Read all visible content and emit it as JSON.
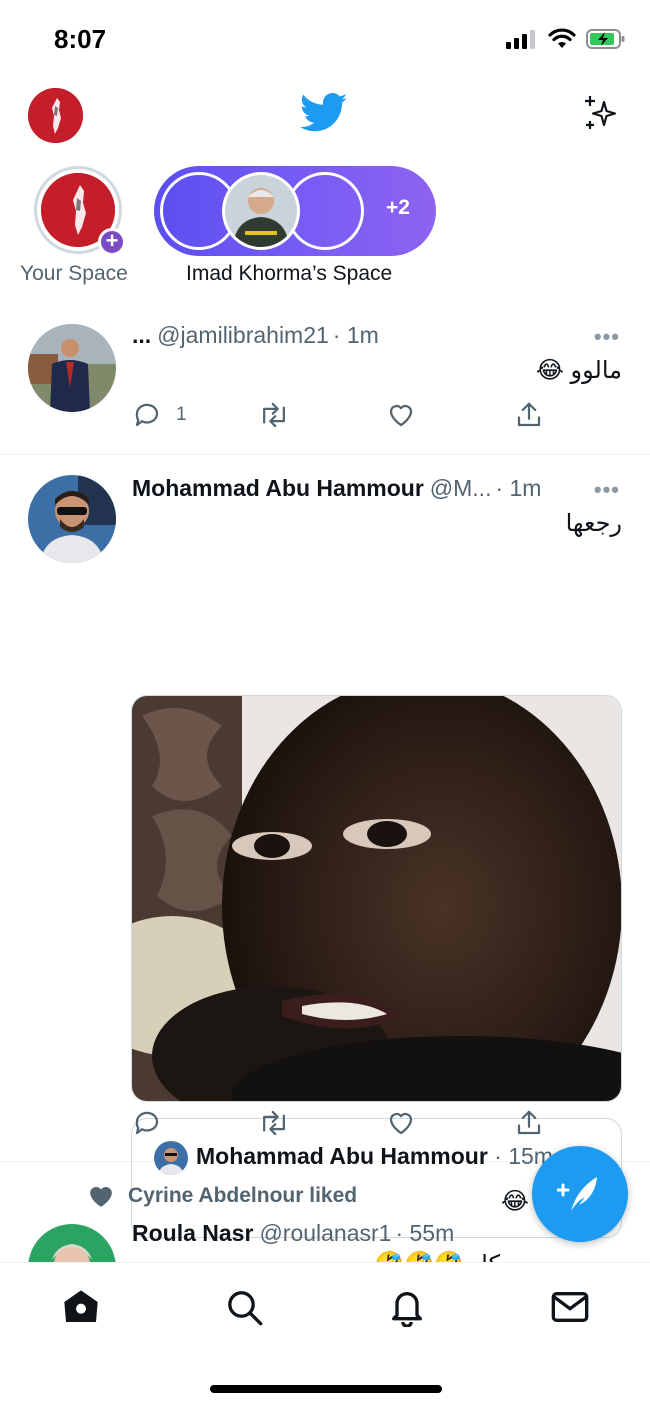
{
  "status_bar": {
    "time": "8:07"
  },
  "nav": {
    "logo_icon": "twitter-bird-icon",
    "sparkle_icon": "sparkle-icon"
  },
  "spaces": {
    "your_space_label": "Your Space",
    "live_space_label": "Imad Khorma’s Space",
    "live_space_extra": "+2"
  },
  "tweets": [
    {
      "name": "...",
      "handle": "@jamilibrahim21",
      "time": "· 1m",
      "text": "مالوو 😂",
      "reply_count": "1"
    },
    {
      "name": "Mohammad Abu Hammour",
      "handle": "@M...",
      "time": "· 1m",
      "text": "رجعها",
      "quote": {
        "name": "Mohammad Abu Hammour",
        "time": "· 15m",
        "text": "شطبها 😂"
      }
    },
    {
      "liked_by": "Cyrine Abdelnour liked",
      "name": "Roula Nasr",
      "handle": "@roulanasr1",
      "time": "· 55m",
      "text": "كل 🤣🤣🤣"
    }
  ],
  "colors": {
    "accent": "#1d9bf0",
    "space_purple": "#6b55f2",
    "muted": "#536471"
  }
}
